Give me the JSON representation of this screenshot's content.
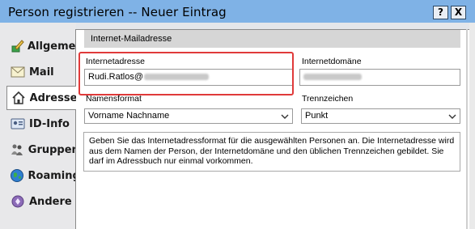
{
  "window": {
    "title": "Person registrieren -- Neuer Eintrag",
    "help_button": "?",
    "close_button": "X"
  },
  "tabs": [
    {
      "label": "Allgemein",
      "icon": "pen-icon"
    },
    {
      "label": "Mail",
      "icon": "envelope-icon"
    },
    {
      "label": "Adresse",
      "icon": "house-icon"
    },
    {
      "label": "ID-Info",
      "icon": "id-card-icon"
    },
    {
      "label": "Gruppen",
      "icon": "people-icon"
    },
    {
      "label": "Roaming",
      "icon": "globe-icon"
    },
    {
      "label": "Andere",
      "icon": "other-icon"
    }
  ],
  "section": {
    "header": "Internet-Mailadresse"
  },
  "form": {
    "address_label": "Internetadresse",
    "address_value": "Rudi.Ratlos@",
    "domain_label": "Internetdomäne",
    "name_format_label": "Namensformat",
    "name_format_value": "Vorname Nachname",
    "separator_label": "Trennzeichen",
    "separator_value": "Punkt"
  },
  "info_text": "Geben Sie das Internetadressformat für die ausgewählten Personen an. Die Internetadresse wird aus dem Namen der Person, der Internetdomäne und den üblichen Trennzeichen gebildet. Sie darf im Adressbuch nur einmal vorkommen.",
  "colors": {
    "titlebar": "#7fb2e6",
    "highlight": "#e03a3a"
  }
}
